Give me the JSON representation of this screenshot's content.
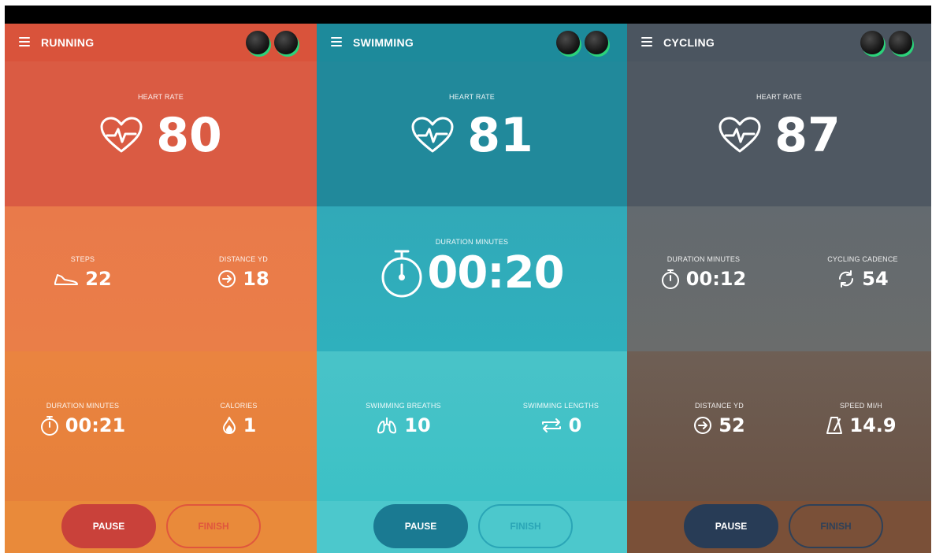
{
  "colors": {
    "running_accent": "#d9533b",
    "swimming_accent": "#1d8a9b",
    "cycling_accent": "#4b5560",
    "earbud_glow": "#2bd27a"
  },
  "panels": [
    {
      "title": "RUNNING",
      "heart_rate": {
        "label": "HEART RATE",
        "value": "80"
      },
      "middle": [
        {
          "label": "STEPS",
          "value": "22",
          "icon": "shoe-icon"
        },
        {
          "label": "DISTANCE YD",
          "value": "18",
          "icon": "arrow-circle-icon"
        }
      ],
      "lower": [
        {
          "label": "DURATION MINUTES",
          "value": "00:21",
          "icon": "stopwatch-icon"
        },
        {
          "label": "CALORIES",
          "value": "1",
          "icon": "flame-icon"
        }
      ],
      "buttons": {
        "pause": "PAUSE",
        "finish": "FINISH"
      }
    },
    {
      "title": "SWIMMING",
      "heart_rate": {
        "label": "HEART RATE",
        "value": "81"
      },
      "duration": {
        "label": "DURATION MINUTES",
        "value": "00:20",
        "icon": "stopwatch-icon"
      },
      "lower": [
        {
          "label": "SWIMMING BREATHS",
          "value": "10",
          "icon": "lungs-icon"
        },
        {
          "label": "SWIMMING LENGTHS",
          "value": "0",
          "icon": "repeat-icon"
        }
      ],
      "buttons": {
        "pause": "PAUSE",
        "finish": "FINISH"
      }
    },
    {
      "title": "CYCLING",
      "heart_rate": {
        "label": "HEART RATE",
        "value": "87"
      },
      "middle": [
        {
          "label": "DURATION MINUTES",
          "value": "00:12",
          "icon": "stopwatch-icon"
        },
        {
          "label": "CYCLING CADENCE",
          "value": "54",
          "icon": "refresh-icon"
        }
      ],
      "lower": [
        {
          "label": "DISTANCE YD",
          "value": "52",
          "icon": "arrow-circle-icon"
        },
        {
          "label": "SPEED MI/H",
          "value": "14.9",
          "icon": "metronome-icon"
        }
      ],
      "buttons": {
        "pause": "PAUSE",
        "finish": "FINISH"
      }
    }
  ]
}
